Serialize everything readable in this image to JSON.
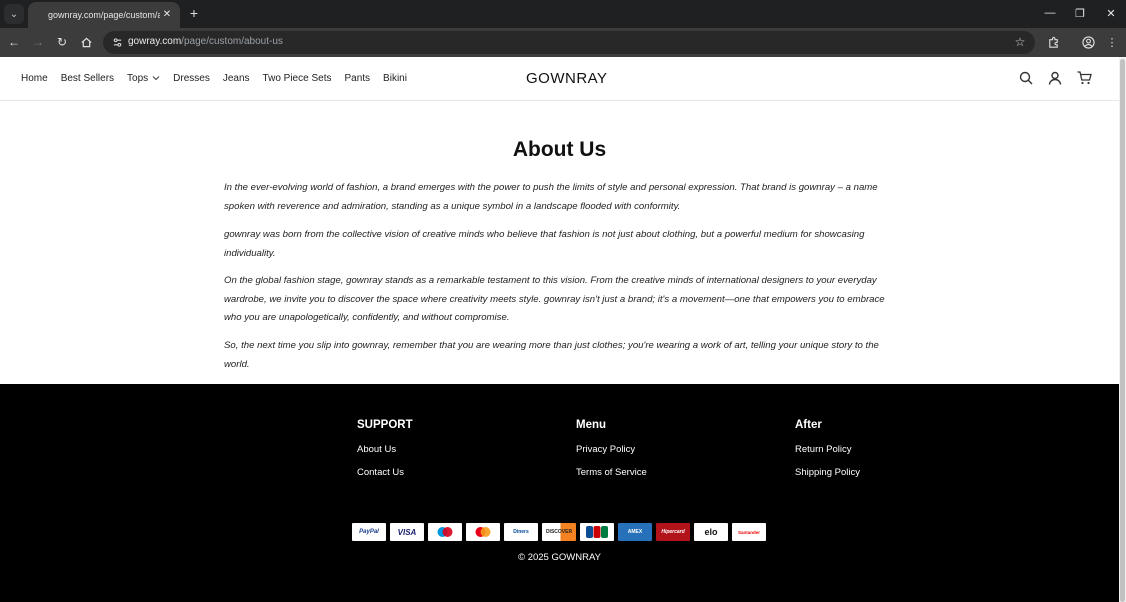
{
  "browser": {
    "tab_title": "gownray.com/page/custom/about-us",
    "url_host": "gowray.com",
    "url_path": "/page/custom/about-us"
  },
  "header": {
    "brand": "GOWNRAY",
    "nav": [
      {
        "label": "Home"
      },
      {
        "label": "Best Sellers"
      },
      {
        "label": "Tops"
      },
      {
        "label": "Dresses"
      },
      {
        "label": "Jeans"
      },
      {
        "label": "Two Piece Sets"
      },
      {
        "label": "Pants"
      },
      {
        "label": "Bikini"
      }
    ]
  },
  "main": {
    "title": "About Us",
    "paragraphs": [
      "In the ever-evolving world of fashion, a brand emerges with the power to push the limits of style and personal expression. That brand is gownray – a name spoken with reverence and admiration, standing as a unique symbol in a landscape flooded with conformity.",
      "gownray was born from the collective vision of creative minds who believe that fashion is not just about clothing, but a powerful medium for showcasing individuality.",
      "On the global fashion stage, gownray stands as a remarkable testament to this vision. From the creative minds of international designers to your everyday wardrobe, we invite you to discover the space where creativity meets style. gownray isn't just a brand; it's a movement—one that empowers you to embrace who you are unapologetically, confidently, and without compromise.",
      "So, the next time you slip into gownray, remember that you are wearing more than just clothes; you're wearing a work of art, telling your unique story to the world."
    ]
  },
  "footer": {
    "columns": [
      {
        "heading": "SUPPORT",
        "links": [
          "About Us",
          "Contact Us"
        ]
      },
      {
        "heading": "Menu",
        "links": [
          "Privacy Policy",
          "Terms of Service"
        ]
      },
      {
        "heading": "After",
        "links": [
          "Return Policy",
          "Shipping Policy"
        ]
      }
    ],
    "payments": [
      "PayPal",
      "VISA",
      "maestro",
      "mastercard",
      "Diners",
      "DISCOVER",
      "JCB",
      "AMEX",
      "Hipercard",
      "elo",
      "Santander"
    ],
    "copyright": "© 2025 GOWNRAY"
  },
  "colors": {
    "footer_bg": "#000000",
    "chrome_bg": "#3c3c3c"
  }
}
